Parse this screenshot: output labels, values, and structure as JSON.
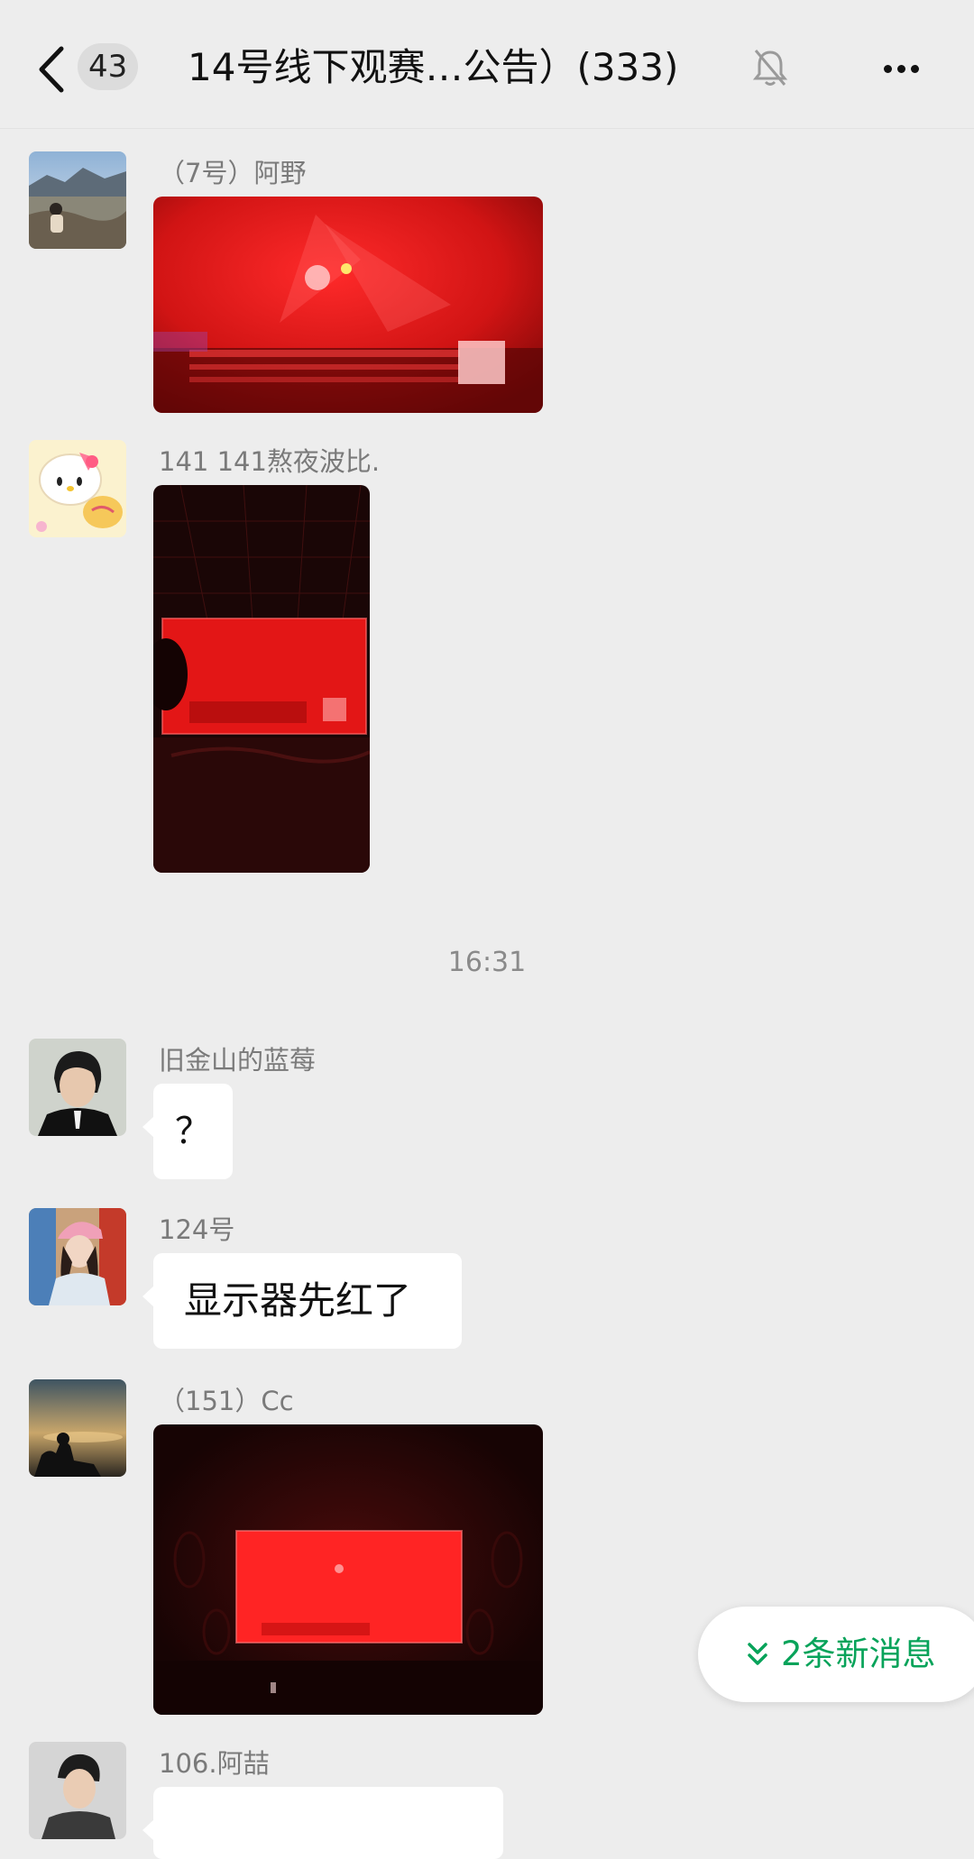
{
  "header": {
    "back_count": "43",
    "title": "14号线下观赛…公告）(333)"
  },
  "messages": [
    {
      "sender": "（7号）阿野",
      "type": "image"
    },
    {
      "sender": "141 141熬夜波比.",
      "type": "image"
    },
    {
      "sender": "旧金山的蓝莓",
      "type": "text",
      "text": "？"
    },
    {
      "sender": "124号",
      "type": "text",
      "text": "显示器先红了"
    },
    {
      "sender": "（151）Cc",
      "type": "image"
    },
    {
      "sender": "106.阿喆",
      "type": "text",
      "text": ""
    }
  ],
  "timestamp": "16:31",
  "new_messages": {
    "label": "2条新消息"
  },
  "icons": {
    "back": "chevron-left-icon",
    "mute": "bell-off-icon",
    "more": "more-dots-icon",
    "new_messages": "double-chevron-down-icon"
  },
  "colors": {
    "background": "#ededed",
    "bubble": "#ffffff",
    "accent_green": "#07a35a",
    "photo_red": "#e01b1b"
  }
}
